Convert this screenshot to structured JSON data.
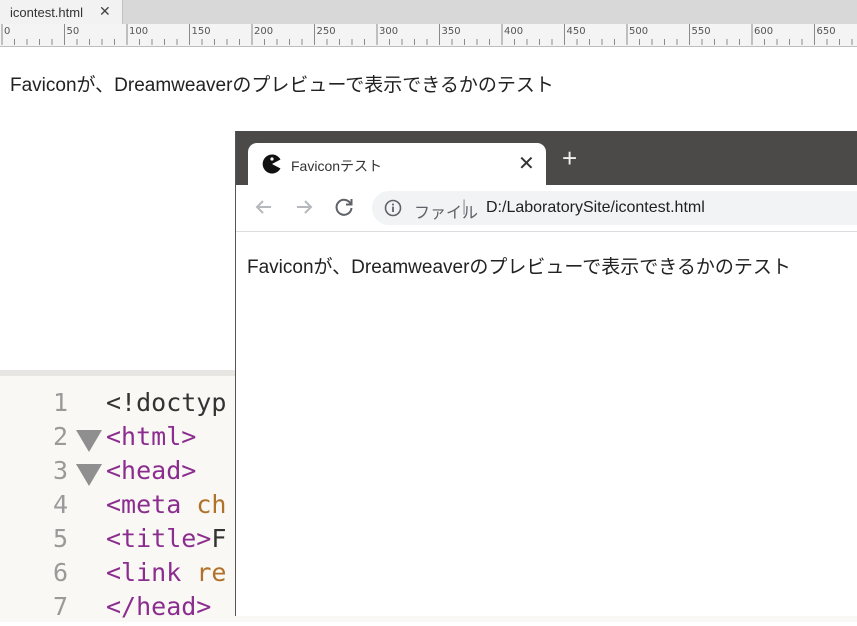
{
  "dreamweaver": {
    "document_tab": {
      "filename": "icontest.html",
      "close_glyph": "✕"
    },
    "ruler_labels": [
      "0",
      "50",
      "100",
      "150",
      "200",
      "250",
      "300",
      "350",
      "400",
      "450",
      "500",
      "550",
      "600",
      "650"
    ],
    "design_view": {
      "text": "Faviconが、Dreamweaverのプレビューで表示できるかのテスト"
    },
    "code_view": {
      "line_numbers": [
        "1",
        "2",
        "3",
        "4",
        "5",
        "6",
        "7"
      ],
      "lines": [
        {
          "tokens": [
            "<!doctyp"
          ]
        },
        {
          "tokens": [
            "<html>"
          ]
        },
        {
          "tokens": [
            "<head>"
          ]
        },
        {
          "tokens": [
            "<meta",
            " ch"
          ]
        },
        {
          "tokens": [
            "<title>",
            "F"
          ]
        },
        {
          "tokens": [
            "<link",
            " re"
          ]
        },
        {
          "tokens": [
            "</head>"
          ]
        }
      ]
    }
  },
  "browser": {
    "tab": {
      "title": "Faviconテスト",
      "close_glyph": "✕",
      "favicon": "pacman-favicon-icon"
    },
    "new_tab_glyph": "+",
    "toolbar": {
      "back_icon": "arrow-left-icon",
      "forward_icon": "arrow-right-icon",
      "reload_icon": "reload-icon"
    },
    "omnibox": {
      "info_icon": "info-circle-icon",
      "scheme_label": "ファイル",
      "separator": "|",
      "url": "D:/LaboratorySite/icontest.html"
    },
    "page": {
      "text": "Faviconが、Dreamweaverのプレビューで表示できるかのテスト"
    }
  },
  "colors": {
    "code_tag": "#8b2d8f",
    "code_attr": "#b0722a",
    "browser_frame": "#4c4a48"
  }
}
